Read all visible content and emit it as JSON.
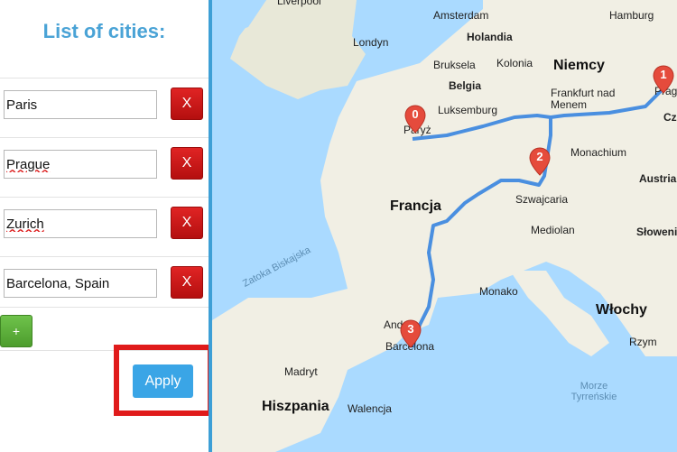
{
  "sidebar": {
    "title": "List of cities:",
    "cities": [
      "Paris",
      "Prague",
      "Zurich",
      "Barcelona, Spain"
    ],
    "delete_label": "X",
    "add_label": "+",
    "apply_label": "Apply"
  },
  "map": {
    "labels": [
      "Liverpool",
      "Amsterdam",
      "Hamburg",
      "Holandia",
      "Londyn",
      "Bruksela",
      "Kolonia",
      "Belgia",
      "Luksemburg",
      "Niemcy",
      "Frankfurt nad Menem",
      "Praga",
      "Czechy",
      "Paryż",
      "Monachium",
      "Austria",
      "Szwajcaria",
      "Francja",
      "Mediolan",
      "Zatoka Biskajska",
      "Monako",
      "Andora",
      "Barcelona",
      "Włochy",
      "Rzym",
      "Madryt",
      "Hiszpania",
      "Walencja",
      "Morze Tyrreńskie",
      "Słowenia"
    ],
    "markers": [
      "0",
      "1",
      "2",
      "3"
    ]
  },
  "colors": {
    "accent": "#3aa5e6",
    "delete": "#c91818",
    "add": "#5aaa36",
    "highlight": "#e01b1b",
    "route": "#4a8fe0",
    "marker": "#e54b3c"
  }
}
